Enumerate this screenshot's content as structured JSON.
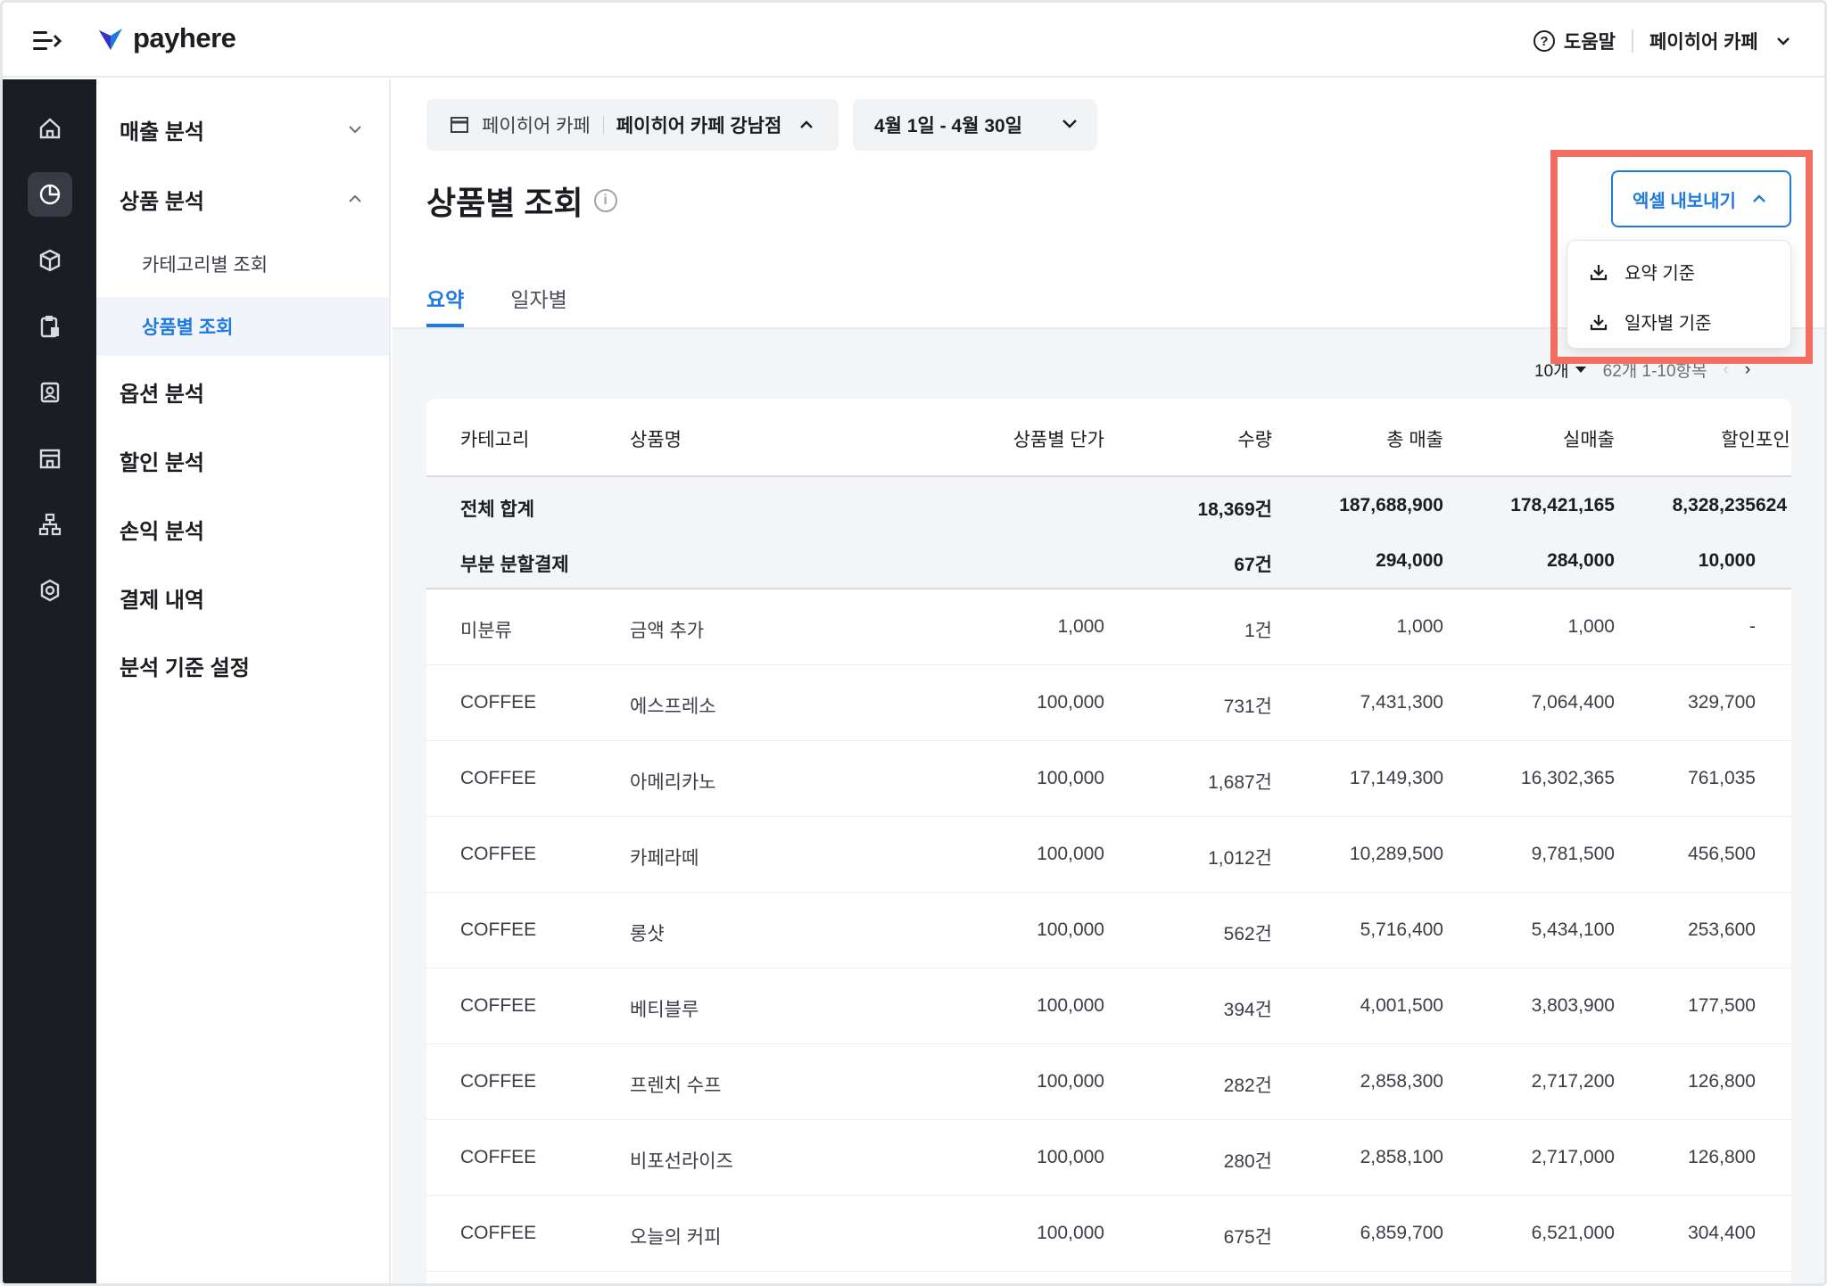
{
  "app": {
    "logo_text": "payhere",
    "help_label": "도움말",
    "store_name": "페이히어 카페"
  },
  "sidebar": {
    "groups": [
      {
        "label": "매출 분석",
        "expanded": false
      },
      {
        "label": "상품 분석",
        "expanded": true
      },
      {
        "label": "옵션 분석"
      },
      {
        "label": "할인 분석"
      },
      {
        "label": "손익 분석"
      },
      {
        "label": "결제 내역"
      },
      {
        "label": "분석 기준 설정"
      }
    ],
    "sub_items": [
      {
        "label": "카테고리별 조회",
        "active": false
      },
      {
        "label": "상품별 조회",
        "active": true
      }
    ],
    "rail_icons": [
      "home-icon",
      "pie-chart-icon",
      "box-icon",
      "clipboard-icon",
      "contact-card-icon",
      "store-icon",
      "org-chart-icon",
      "settings-icon"
    ]
  },
  "filters": {
    "brand": "페이히어 카페",
    "branch": "페이히어 카페 강남점",
    "date_range": "4월 1일 - 4월 30일"
  },
  "page": {
    "title": "상품별 조회",
    "tabs": [
      {
        "label": "요약",
        "active": true
      },
      {
        "label": "일자별",
        "active": false
      }
    ]
  },
  "export": {
    "button_label": "엑셀 내보내기",
    "options": [
      "요약 기준",
      "일자별 기준"
    ]
  },
  "pager": {
    "page_size": "10개",
    "range_text": "62개 1-10항목"
  },
  "table": {
    "headers": [
      "카테고리",
      "상품명",
      "상품별 단가",
      "수량",
      "총 매출",
      "실매출",
      "할인",
      "포인"
    ],
    "totals": [
      {
        "label": "전체 합계",
        "qty": "18,369건",
        "gross": "187,688,900",
        "net": "178,421,165",
        "discount": "8,328,235",
        "point": "624"
      },
      {
        "label": "부분 분할결제",
        "qty": "67건",
        "gross": "294,000",
        "net": "284,000",
        "discount": "10,000",
        "point": ""
      }
    ],
    "rows": [
      {
        "category": "미분류",
        "product": "금액 추가",
        "unit_price": "1,000",
        "qty": "1건",
        "gross": "1,000",
        "net": "1,000",
        "discount": "-"
      },
      {
        "category": "COFFEE",
        "product": "에스프레소",
        "unit_price": "100,000",
        "qty": "731건",
        "gross": "7,431,300",
        "net": "7,064,400",
        "discount": "329,700"
      },
      {
        "category": "COFFEE",
        "product": "아메리카노",
        "unit_price": "100,000",
        "qty": "1,687건",
        "gross": "17,149,300",
        "net": "16,302,365",
        "discount": "761,035"
      },
      {
        "category": "COFFEE",
        "product": "카페라떼",
        "unit_price": "100,000",
        "qty": "1,012건",
        "gross": "10,289,500",
        "net": "9,781,500",
        "discount": "456,500"
      },
      {
        "category": "COFFEE",
        "product": "롱샷",
        "unit_price": "100,000",
        "qty": "562건",
        "gross": "5,716,400",
        "net": "5,434,100",
        "discount": "253,600"
      },
      {
        "category": "COFFEE",
        "product": "베티블루",
        "unit_price": "100,000",
        "qty": "394건",
        "gross": "4,001,500",
        "net": "3,803,900",
        "discount": "177,500"
      },
      {
        "category": "COFFEE",
        "product": "프렌치 수프",
        "unit_price": "100,000",
        "qty": "282건",
        "gross": "2,858,300",
        "net": "2,717,200",
        "discount": "126,800"
      },
      {
        "category": "COFFEE",
        "product": "비포선라이즈",
        "unit_price": "100,000",
        "qty": "280건",
        "gross": "2,858,100",
        "net": "2,717,000",
        "discount": "126,800"
      },
      {
        "category": "COFFEE",
        "product": "오늘의 커피",
        "unit_price": "100,000",
        "qty": "675건",
        "gross": "6,859,700",
        "net": "6,521,000",
        "discount": "304,400"
      }
    ]
  },
  "colors": {
    "accent": "#1f7ae0",
    "rail_bg": "#1b1d24",
    "highlight": "#f26d5f"
  }
}
